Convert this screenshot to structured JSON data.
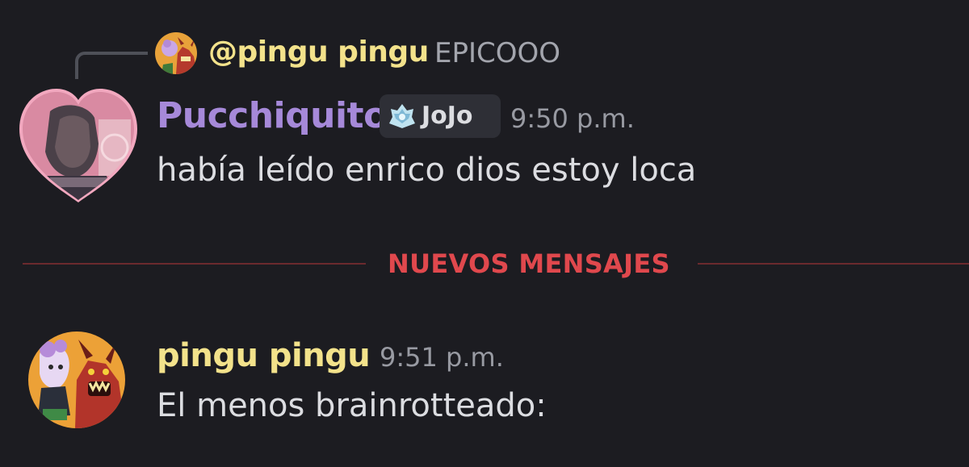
{
  "reply": {
    "author": "@pingu pingu",
    "preview": "EPICOOO"
  },
  "message1": {
    "author": "Pucchiquito",
    "tag": "JoJo",
    "time": "9:50 p.m.",
    "text": "había leído enrico dios estoy loca"
  },
  "divider": {
    "label": "NUEVOS MENSAJES"
  },
  "message2": {
    "author": "pingu pingu",
    "time": "9:51 p.m.",
    "text": "El menos brainrotteado:"
  },
  "colors": {
    "background": "#1c1c21",
    "author_yellow": "#f3e28b",
    "author_purple": "#a689d9",
    "new_messages_red": "#e0484d"
  }
}
